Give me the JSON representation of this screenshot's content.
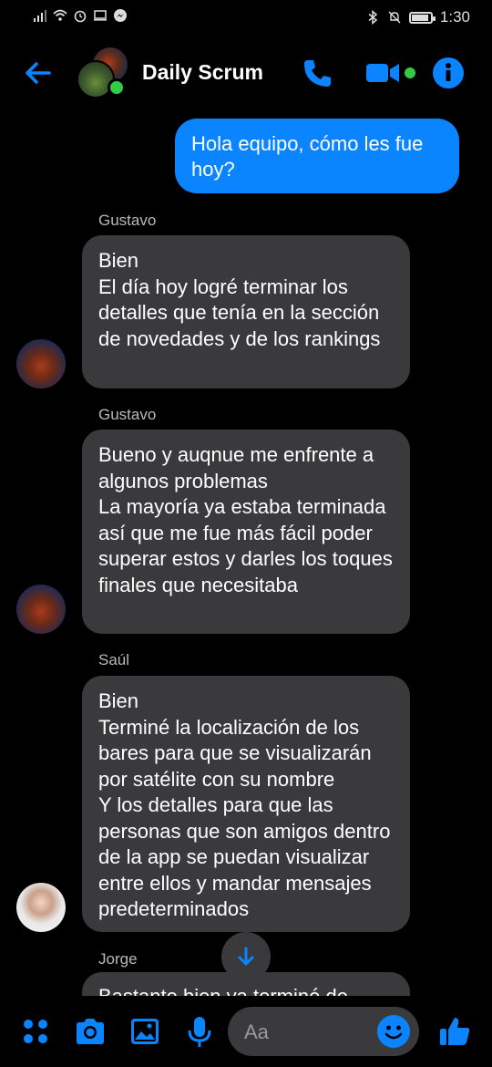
{
  "status_bar": {
    "time": "1:30",
    "battery_level": 0.9
  },
  "header": {
    "title": "Daily Scrum"
  },
  "messages": [
    {
      "type": "outgoing",
      "text": "Hola equipo, cómo les fue hoy?"
    },
    {
      "type": "incoming",
      "sender": "Gustavo",
      "text": "Bien\nEl día hoy logré terminar los detalles que tenía en la sección de novedades y de los rankings"
    },
    {
      "type": "incoming",
      "sender": "Gustavo",
      "text": "Bueno y auqnue me enfrente a algunos problemas\nLa mayoría ya estaba terminada así que me fue más fácil poder superar estos y darles los toques finales que necesitaba"
    },
    {
      "type": "incoming",
      "sender": "Saúl",
      "text": "Bien\nTerminé la localización de los bares para que se visualizarán por satélite con su nombre\nY los detalles para que las personas que son amigos dentro de la app se puedan visualizar entre ellos y mandar mensajes predeterminados"
    },
    {
      "type": "incoming",
      "sender": "Jorge",
      "text": "Bastante bien ya terminé de"
    }
  ],
  "composer": {
    "placeholder": "Aa"
  },
  "colors": {
    "accent": "#0a84ff",
    "bubble_in": "#3a3a3c",
    "online": "#31cc46",
    "background": "#000000"
  }
}
